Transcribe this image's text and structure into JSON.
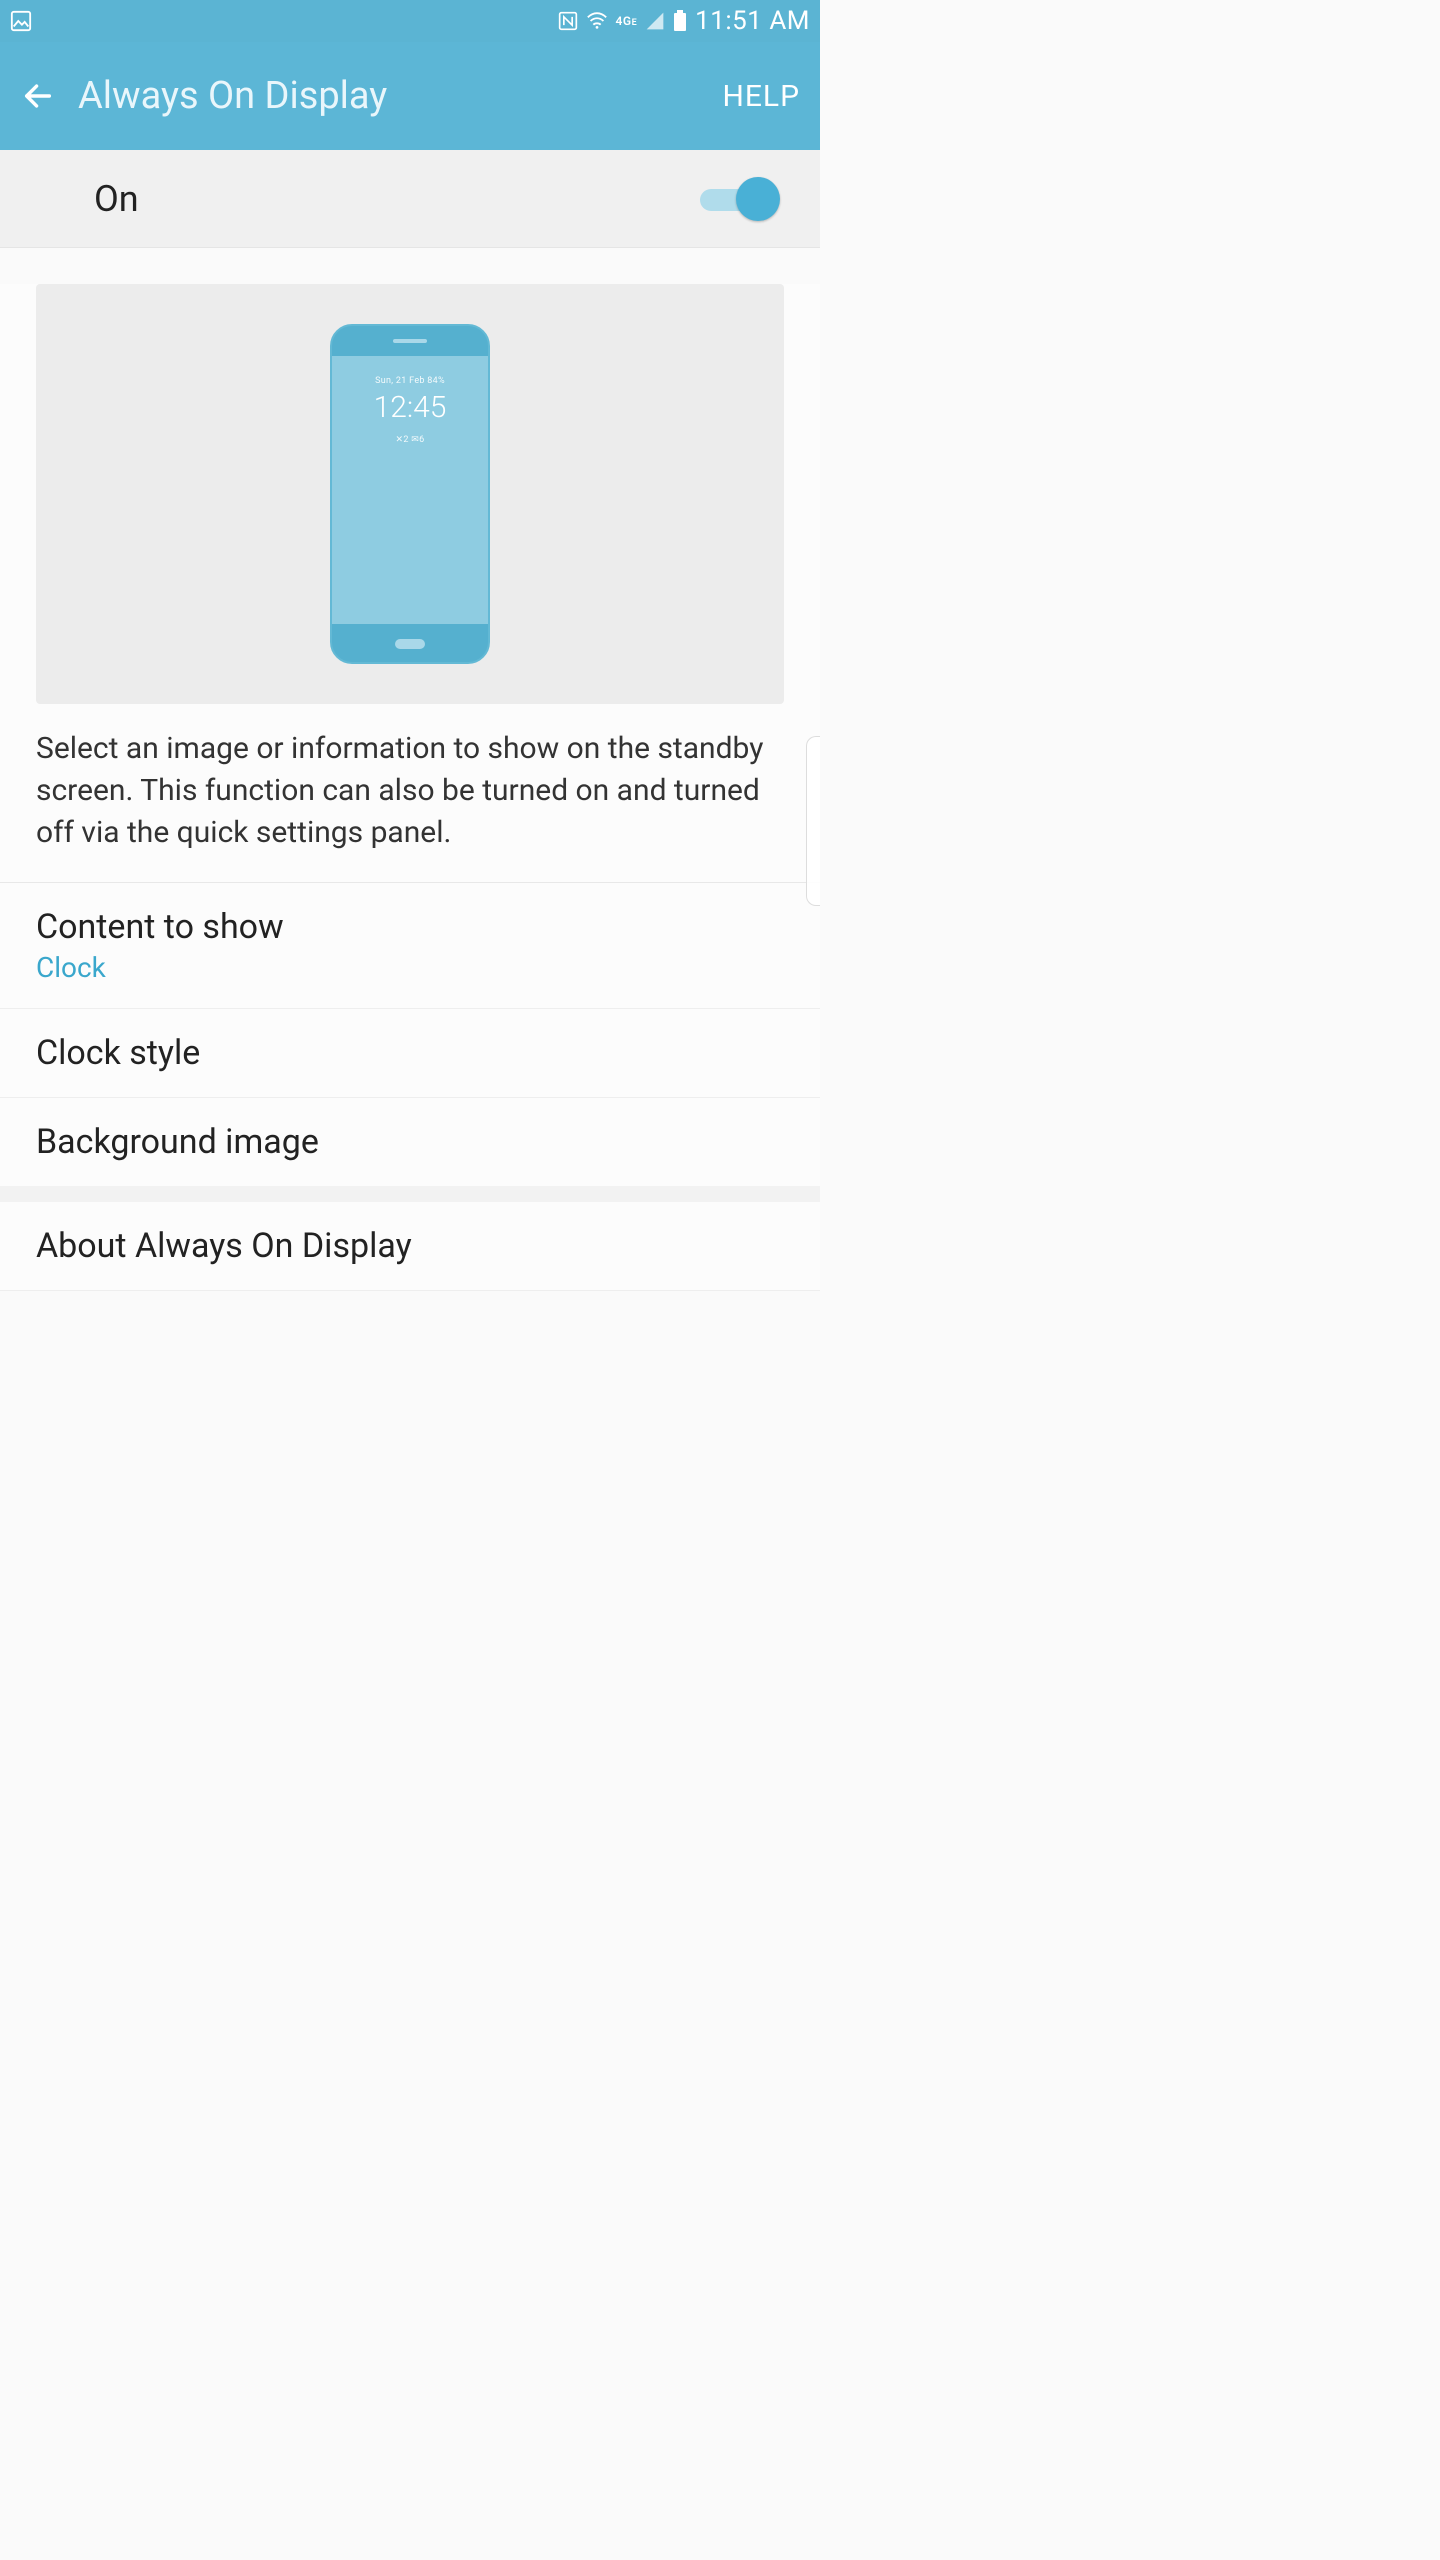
{
  "status": {
    "time": "11:51 AM",
    "nfc": "N",
    "wifi": true,
    "signal": "4G",
    "battery": true
  },
  "appbar": {
    "title": "Always On Display",
    "help": "HELP"
  },
  "master_toggle": {
    "label": "On",
    "state": "on"
  },
  "preview": {
    "date_line": "Sun, 21 Feb  84%",
    "clock": "12:45",
    "icons_line": "✕2   ✉6"
  },
  "description": "Select an image or information to show on the standby screen. This function can also be turned on and turned off via the quick settings panel.",
  "items": [
    {
      "title": "Content to show",
      "sub": "Clock"
    },
    {
      "title": "Clock style"
    },
    {
      "title": "Background image"
    }
  ],
  "about": {
    "title": "About Always On Display"
  }
}
